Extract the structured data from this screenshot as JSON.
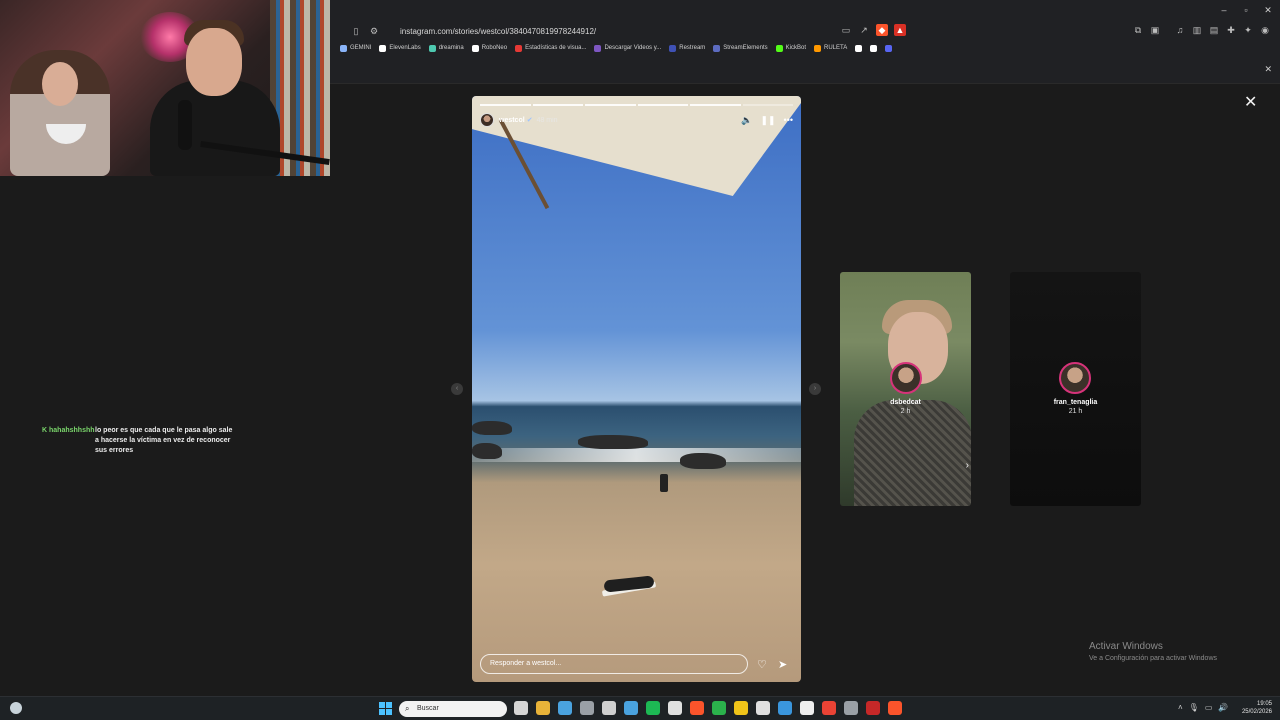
{
  "browser": {
    "url": "instagram.com/stories/westcol/3840470819978244912/",
    "bookmarks": [
      {
        "label": "GEMINI",
        "color": "#8ab4f8"
      },
      {
        "label": "ElevenLabs",
        "color": "#ffffff"
      },
      {
        "label": "dreamina",
        "color": "#4ec9b0"
      },
      {
        "label": "RoboNeo",
        "color": "#ffffff"
      },
      {
        "label": "Estadísticas de visua...",
        "color": "#e53935"
      },
      {
        "label": "Descargar Videos y...",
        "color": "#7e57c2"
      },
      {
        "label": "Restream",
        "color": "#3f51b5"
      },
      {
        "label": "StreamElements",
        "color": "#5c6bc0"
      },
      {
        "label": "KickBot",
        "color": "#53fc18"
      },
      {
        "label": "RULETA",
        "color": "#ff9800"
      }
    ]
  },
  "story": {
    "username": "westcol",
    "time": "48 min",
    "reply_placeholder": "Responder a westcol...",
    "segments_total": 6,
    "segments_done": 5
  },
  "previews": [
    {
      "name": "dsbedcat",
      "time": "2 h"
    },
    {
      "name": "fran_tenaglia",
      "time": "21 h"
    }
  ],
  "chat": {
    "user": "hahahshhshh",
    "message": "lo peor es que cada que le pasa algo sale a hacerse la víctima en vez de reconocer sus errores"
  },
  "watermark": {
    "title": "Activar Windows",
    "subtitle": "Ve a Configuración para activar Windows"
  },
  "taskbar": {
    "search_placeholder": "Buscar",
    "time": "19:05",
    "date": "25/02/2026",
    "apps": [
      "#d6d6d6",
      "#e8b339",
      "#4aa3df",
      "#9aa0a6",
      "#cfcfcf",
      "#4aa3df",
      "#1db954",
      "#e0e0e0",
      "#fb542b",
      "#2bb24c",
      "#f0c419",
      "#e0e0e0",
      "#3a96dd",
      "#eeeeee",
      "#ea4335",
      "#9aa0a6",
      "#c62828",
      "#fb542b"
    ]
  }
}
